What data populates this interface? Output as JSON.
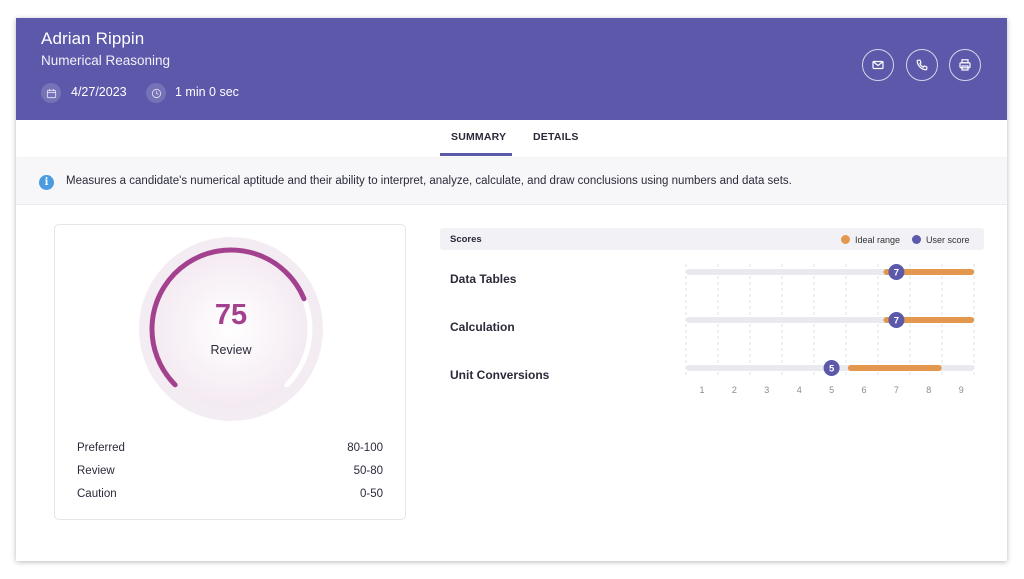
{
  "header": {
    "name": "Adrian Rippin",
    "test_name": "Numerical Reasoning",
    "date": "4/27/2023",
    "duration": "1 min 0 sec",
    "icons": {
      "date": "calendar-icon",
      "duration": "clock-icon"
    },
    "actions": [
      {
        "name": "email-button",
        "icon": "mail-icon"
      },
      {
        "name": "call-button",
        "icon": "phone-icon"
      },
      {
        "name": "print-button",
        "icon": "printer-icon"
      }
    ],
    "color": "#5c58aa"
  },
  "tabs": [
    {
      "label": "SUMMARY",
      "active": true
    },
    {
      "label": "DETAILS",
      "active": false
    }
  ],
  "info": {
    "icon": "info-icon",
    "text": "Measures a candidate's numerical aptitude and their ability to interpret, analyze, calculate, and draw conclusions using numbers and data sets."
  },
  "overall": {
    "score": "75",
    "status": "Review",
    "gauge_fraction": 0.75,
    "gauge_color": "#a4418f",
    "ranges": [
      {
        "label": "Preferred",
        "value": "80-100"
      },
      {
        "label": "Review",
        "value": "50-80"
      },
      {
        "label": "Caution",
        "value": "0-50"
      }
    ]
  },
  "scores": {
    "title": "Scores",
    "legend": {
      "ideal": "Ideal range",
      "user": "User score"
    },
    "ideal_color": "#e4984f",
    "user_color": "#5c58aa",
    "ticks": [
      "1",
      "2",
      "3",
      "4",
      "5",
      "6",
      "7",
      "8",
      "9"
    ],
    "rows": [
      {
        "label": "Data Tables",
        "ideal_min": 6.6,
        "ideal_max": 9.4,
        "score": "7"
      },
      {
        "label": "Calculation",
        "ideal_min": 6.6,
        "ideal_max": 9.4,
        "score": "7"
      },
      {
        "label": "Unit Conversions",
        "ideal_min": 5.5,
        "ideal_max": 8.4,
        "score": "5"
      }
    ]
  }
}
